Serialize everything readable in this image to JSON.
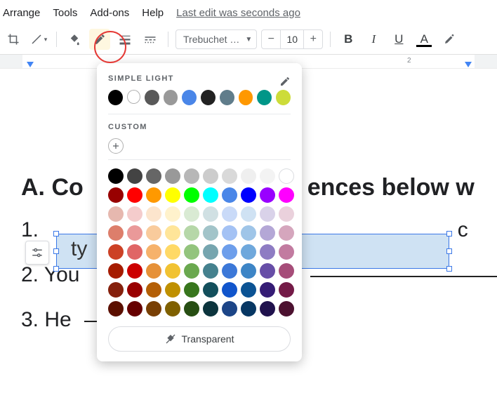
{
  "menubar": {
    "arrange": "Arrange",
    "tools": "Tools",
    "addons": "Add-ons",
    "help": "Help",
    "last_edit": "Last edit was seconds ago"
  },
  "toolbar": {
    "font_name": "Trebuchet …",
    "font_size": "10",
    "minus": "−",
    "plus": "+",
    "bold": "B",
    "italic": "I",
    "underline": "U",
    "textcolor": "A"
  },
  "ruler": {
    "label_2": "2"
  },
  "doc": {
    "heading_left": "A. Co",
    "heading_right": "ences below w",
    "line1_prefix": "1.",
    "line1_trail": "c",
    "selected_text": "ty",
    "line2": "2. You",
    "line3": "3. He"
  },
  "colorpicker": {
    "title_theme": "SIMPLE LIGHT",
    "title_custom": "CUSTOM",
    "transparent_label": "Transparent",
    "theme_swatches": [
      "#000000",
      "hollow",
      "#595959",
      "#999999",
      "#4a86e8",
      "#222222",
      "#607d8b",
      "#ff9800",
      "#009688",
      "#cddc39"
    ],
    "grid_colors": [
      "#000000",
      "#434343",
      "#666666",
      "#999999",
      "#b7b7b7",
      "#cccccc",
      "#d9d9d9",
      "#efefef",
      "#f3f3f3",
      "#ffffff",
      "#980000",
      "#ff0000",
      "#ff9900",
      "#ffff00",
      "#00ff00",
      "#00ffff",
      "#4a86e8",
      "#0000ff",
      "#9900ff",
      "#ff00ff",
      "#e6b8af",
      "#f4cccc",
      "#fce5cd",
      "#fff2cc",
      "#d9ead3",
      "#d0e0e3",
      "#c9daf8",
      "#cfe2f3",
      "#d9d2e9",
      "#ead1dc",
      "#dd7e6b",
      "#ea9999",
      "#f9cb9c",
      "#ffe599",
      "#b6d7a8",
      "#a2c4c9",
      "#a4c2f4",
      "#9fc5e8",
      "#b4a7d6",
      "#d5a6bd",
      "#cc4125",
      "#e06666",
      "#f6b26b",
      "#ffd966",
      "#93c47d",
      "#76a5af",
      "#6d9eeb",
      "#6fa8dc",
      "#8e7cc3",
      "#c27ba0",
      "#a61c00",
      "#cc0000",
      "#e69138",
      "#f1c232",
      "#6aa84f",
      "#45818e",
      "#3c78d8",
      "#3d85c6",
      "#674ea7",
      "#a64d79",
      "#85200c",
      "#990000",
      "#b45f06",
      "#bf9000",
      "#38761d",
      "#134f5c",
      "#1155cc",
      "#0b5394",
      "#351c75",
      "#741b47",
      "#5b0f00",
      "#660000",
      "#783f04",
      "#7f6000",
      "#274e13",
      "#0c343d",
      "#1c4587",
      "#073763",
      "#20124d",
      "#4c1130"
    ]
  }
}
